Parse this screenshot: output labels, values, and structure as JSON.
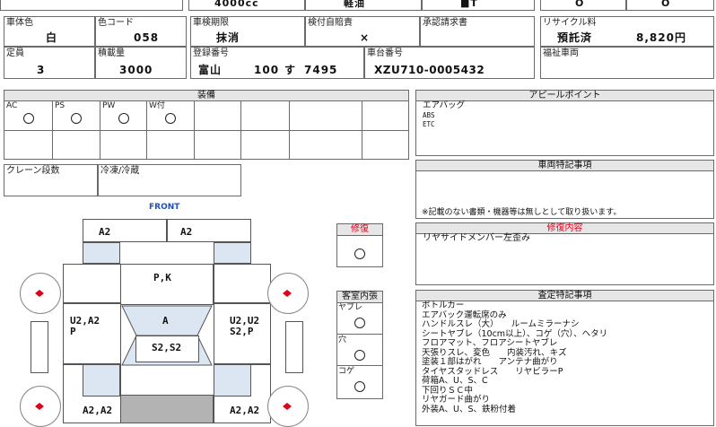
{
  "top_partial": {
    "cc": "4000cc",
    "fuel": "軽油",
    "mid": "■T",
    "c1": "O",
    "c2": "O"
  },
  "info": {
    "body_color_label": "車体色",
    "body_color": "白",
    "color_code_label": "色コード",
    "color_code": "058",
    "inspection_label": "車検期限",
    "inspection": "抹消",
    "insurance_label": "検付自賠責",
    "insurance": "×",
    "approval_label": "承認請求書",
    "approval": "",
    "recycle_label": "リサイクル料",
    "recycle_status": "預託済",
    "recycle_fee": "8,820円",
    "capacity_label": "定員",
    "capacity": "3",
    "load_label": "積載量",
    "load": "3000",
    "reg_label": "登録番号",
    "reg_area": "富山",
    "reg_class": "100",
    "reg_kana": "す",
    "reg_num": "7495",
    "chassis_label": "車台番号",
    "chassis": "XZU710-0005432",
    "welfare_label": "福祉車両",
    "welfare": ""
  },
  "equipment": {
    "title": "装備",
    "items": [
      {
        "label": "AC",
        "mark": "O"
      },
      {
        "label": "PS",
        "mark": "O"
      },
      {
        "label": "PW",
        "mark": "O"
      },
      {
        "label": "W付",
        "mark": "O"
      }
    ],
    "crane_label": "クレーン段数",
    "freezer_label": "冷凍/冷蔵"
  },
  "diagram": {
    "front_label": "FRONT",
    "panels": {
      "bumper_left": "A2",
      "bumper_right": "A2",
      "hood": "P,K",
      "left_side": "U2,A2\nP",
      "windshield": "A",
      "right_side": "U2,U2\nS2,P",
      "roof": "S2,S2",
      "bottom_left": "A2,A2",
      "bottom_right": "A2,A2"
    }
  },
  "repair": {
    "title": "修復",
    "mark": "O"
  },
  "interior": {
    "title": "客室内張",
    "items": [
      {
        "label": "ヤブレ",
        "mark": "O"
      },
      {
        "label": "穴",
        "mark": "O"
      },
      {
        "label": "コゲ",
        "mark": "O"
      }
    ]
  },
  "appeal": {
    "title": "アピールポイント",
    "lines": [
      "エアバッグ",
      "ABS",
      "ETC"
    ]
  },
  "vehicle_notes": {
    "title": "車両特記事項",
    "text": "※記載のない書類・機器等は無しとして取り扱います。"
  },
  "repair_details": {
    "title": "修復内容",
    "lines": [
      "リヤサイドメンバー左歪み"
    ]
  },
  "assessment": {
    "title": "査定特記事項",
    "lines": [
      "ボトルカー",
      "エアバック運転席のみ",
      "ハンドルスレ（大）　　ルームミラーナシ",
      "シートヤブレ（10cm以上）、コゲ（穴）、ヘタリ",
      "フロアマット、フロアシートヤブレ",
      "天張りスレ、変色　　内装汚れ、キズ",
      "塗装１部はがれ　　アンテナ曲がり",
      "タイヤスタッドレス　　リヤビラーP",
      "荷箱A、U、S、C",
      "下回りＳＣ中",
      "リヤガード曲がり",
      "外装A、U、S、鉄粉付着"
    ]
  },
  "colors": {
    "header_bg": "#e6e6e6",
    "repair_red": "#e0001a",
    "front_blue": "#1f4fb8",
    "glass_blue": "#dbe6f2"
  }
}
